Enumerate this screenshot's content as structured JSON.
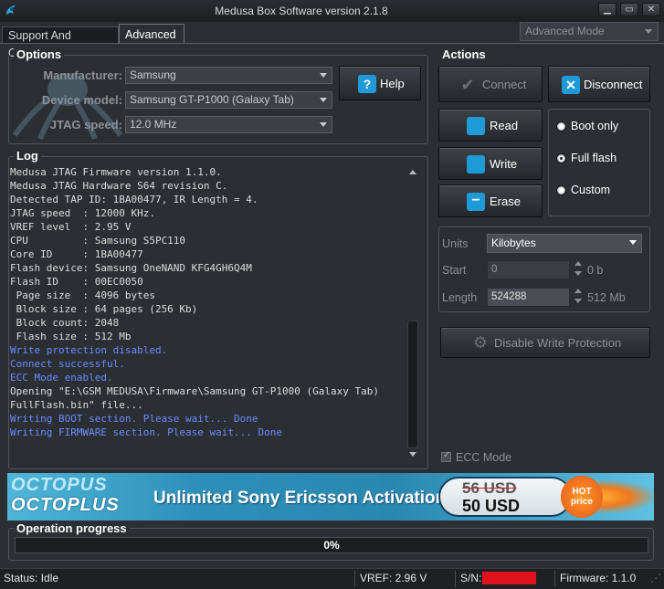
{
  "window": {
    "title": "Medusa Box Software version 2.1.8"
  },
  "tabs": [
    {
      "label": "Support And Options"
    },
    {
      "label": "Advanced"
    }
  ],
  "mode_select": {
    "value": "Advanced Mode"
  },
  "options": {
    "title": "Options",
    "manufacturer_label": "Manufacturer:",
    "manufacturer_value": "Samsung",
    "device_label": "Device model:",
    "device_value": "Samsung GT-P1000 (Galaxy Tab)",
    "jtag_label": "JTAG speed:",
    "jtag_value": "12.0 MHz",
    "help_label": "Help"
  },
  "log": {
    "title": "Log",
    "lines": [
      {
        "text": "Medusa JTAG Firmware version 1.1.0.",
        "color": "white"
      },
      {
        "text": "Medusa JTAG Hardware S64 revision C.",
        "color": "white"
      },
      {
        "text": "Detected TAP ID: 1BA00477, IR Length = 4.",
        "color": "white"
      },
      {
        "text": "JTAG speed  : 12000 KHz.",
        "color": "white"
      },
      {
        "text": "VREF level  : 2.95 V",
        "color": "white"
      },
      {
        "text": "CPU         : Samsung S5PC110",
        "color": "white"
      },
      {
        "text": "Core ID     : 1BA00477",
        "color": "white"
      },
      {
        "text": "Flash device: Samsung OneNAND KFG4GH6Q4M",
        "color": "white"
      },
      {
        "text": "Flash ID    : 00EC0050",
        "color": "white"
      },
      {
        "text": " Page size  : 4096 bytes",
        "color": "white"
      },
      {
        "text": " Block size : 64 pages (256 Kb)",
        "color": "white"
      },
      {
        "text": " Block count: 2048",
        "color": "white"
      },
      {
        "text": " Flash size : 512 Mb",
        "color": "white"
      },
      {
        "text": "Write protection disabled.",
        "color": "blue"
      },
      {
        "text": "Connect successful.",
        "color": "blue"
      },
      {
        "text": "ECC Mode enabled.",
        "color": "blue"
      },
      {
        "text": "Opening \"E:\\GSM MEDUSA\\Firmware\\Samsung GT-P1000 (Galaxy Tab)",
        "color": "white"
      },
      {
        "text": "FullFlash.bin\" file...",
        "color": "white"
      },
      {
        "text": "Writing BOOT section. Please wait... Done",
        "color": "blue"
      },
      {
        "text": "Writing FIRMWARE section. Please wait... Done",
        "color": "blue"
      }
    ]
  },
  "actions": {
    "title": "Actions",
    "connect": "Connect",
    "disconnect": "Disconnect",
    "read": "Read",
    "write": "Write",
    "erase": "Erase",
    "radios": [
      {
        "label": "Boot only",
        "checked": false
      },
      {
        "label": "Full flash",
        "checked": true
      },
      {
        "label": "Custom",
        "checked": false
      }
    ],
    "units_label": "Units",
    "units_value": "Kilobytes",
    "start_label": "Start",
    "start_value": "0",
    "start_unit": "0 b",
    "length_label": "Length",
    "length_value": "524288",
    "length_unit": "512 Mb",
    "disable_wp": "Disable Write Protection",
    "ecc_label": "ECC Mode"
  },
  "banner": {
    "brand_top": "OCTOPUS",
    "brand_bottom": "OCTOPLUS",
    "headline": "Unlimited Sony Ericsson Activation",
    "old_price": "56 USD",
    "new_price": "50 USD",
    "hot_1": "HOT",
    "hot_2": "price"
  },
  "progress": {
    "title": "Operation progress",
    "percent": 0,
    "label": "0%"
  },
  "status": {
    "status": "Status: Idle",
    "vref": "VREF: 2.96 V",
    "sn_label": "S/N:",
    "firmware": "Firmware: 1.1.0"
  },
  "colors": {
    "accent": "#1b9bd1",
    "log_blue": "#6b8cff",
    "redaction": "#e0121b"
  }
}
